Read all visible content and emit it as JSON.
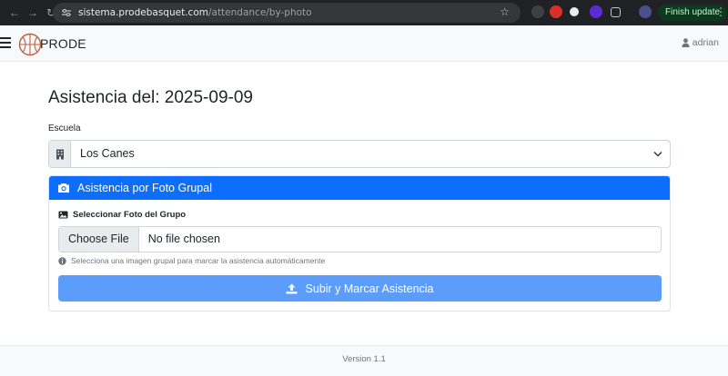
{
  "browser": {
    "url_host": "sistema.prodebasquet.com",
    "url_path": "/attendance/by-photo",
    "update_label": "Finish update"
  },
  "navbar": {
    "brand": "PRODE",
    "user": "adrian"
  },
  "page": {
    "title": "Asistencia del: 2025-09-09",
    "school_label": "Escuela",
    "school_value": "Los Canes"
  },
  "card": {
    "header": "Asistencia por Foto Grupal",
    "photo_label": "Seleccionar Foto del Grupo",
    "file_button": "Choose File",
    "file_status": "No file chosen",
    "help": "Selecciona una imagen grupal para marcar la asistencia automáticamente",
    "submit": "Subir y Marcar Asistencia"
  },
  "footer": {
    "version": "Version 1.1"
  },
  "colors": {
    "primary": "#0d6efd",
    "submit_disabled": "#5c9cfa",
    "chrome_bg": "#202124"
  }
}
